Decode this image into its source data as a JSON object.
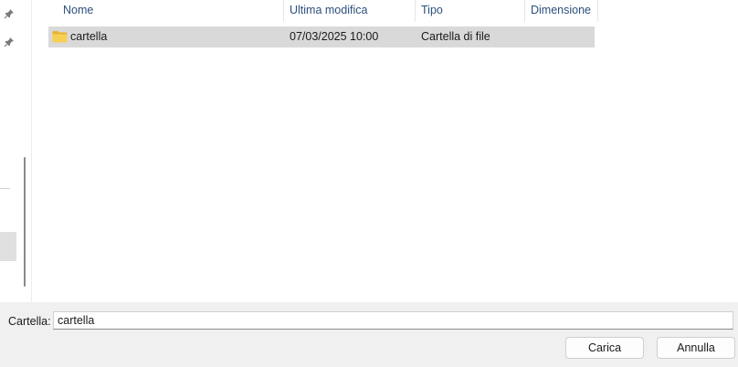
{
  "columns": {
    "name": "Nome",
    "modified": "Ultima modifica",
    "type": "Tipo",
    "size": "Dimensione"
  },
  "files": [
    {
      "name": "cartella",
      "modified": "07/03/2025 10:00",
      "type": "Cartella di file",
      "size": "",
      "icon": "folder-icon",
      "selected": true
    }
  ],
  "footer": {
    "field_label": "Cartella:",
    "field_value": "cartella",
    "primary_button": "Carica",
    "cancel_button": "Annulla"
  },
  "nav": {
    "pinned_icons": [
      "pin-icon",
      "pin-icon"
    ]
  },
  "colors": {
    "header_text": "#2c4f7c",
    "selected_row": "#d9d9d9",
    "folder": "#f4c542",
    "bottom_bar": "#f0f0f0"
  }
}
